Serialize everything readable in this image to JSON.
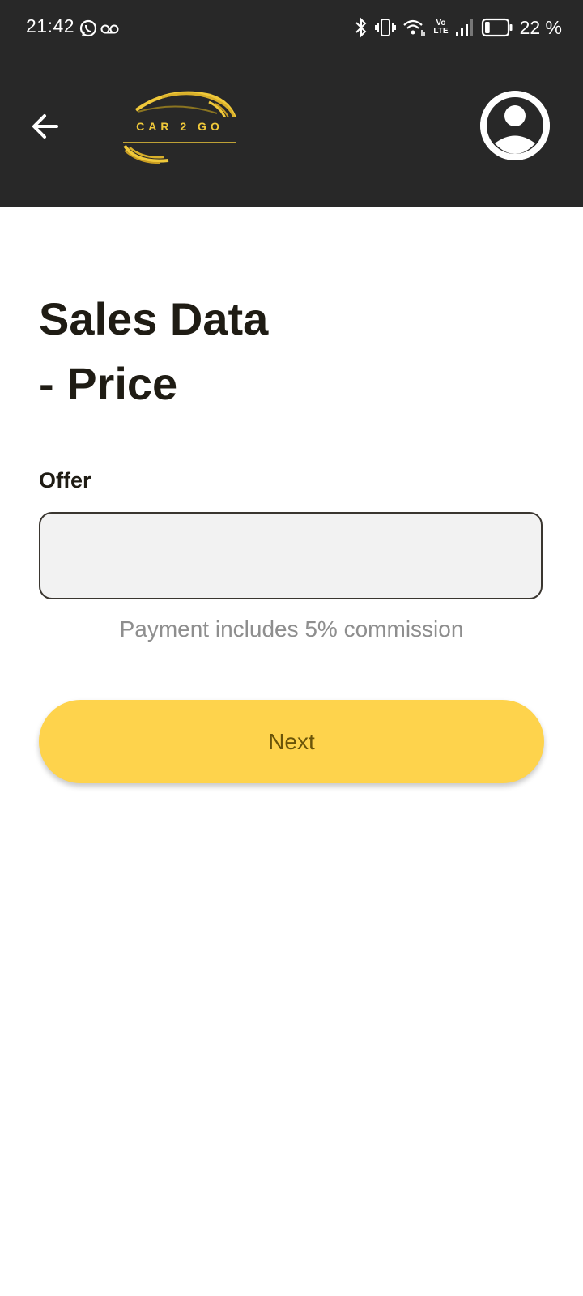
{
  "status_bar": {
    "time": "21:42",
    "volte_top": "Vo",
    "volte_bottom": "LTE",
    "battery": "22 %",
    "battery_level": 0.22
  },
  "app_bar": {
    "logo_text": "CAR 2 GO"
  },
  "page": {
    "title_line1": "Sales Data",
    "title_line2": "- Price"
  },
  "form": {
    "offer_label": "Offer",
    "offer_value": "",
    "helper_text": "Payment includes 5% commission",
    "next_label": "Next"
  },
  "colors": {
    "app_bar_bg": "#282828",
    "accent": "#fed34c",
    "logo_gold": "#f0c93a"
  }
}
